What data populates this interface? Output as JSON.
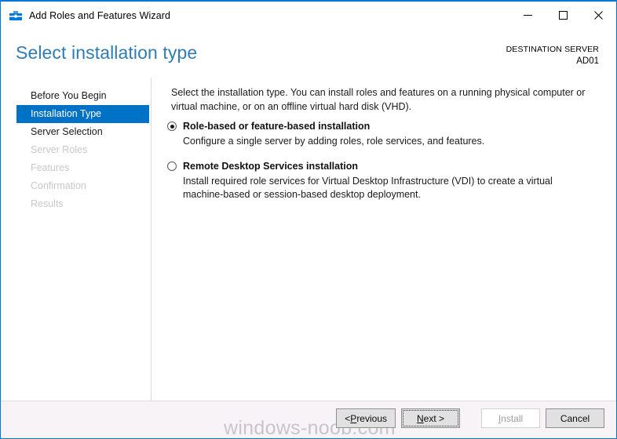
{
  "window": {
    "title": "Add Roles and Features Wizard",
    "icon": "roles-features-toolbox-icon",
    "accent_color": "#0078d7"
  },
  "window_controls": {
    "minimize": "minimize-icon",
    "maximize": "maximize-icon",
    "close": "close-icon"
  },
  "header": {
    "page_title": "Select installation type",
    "destination_label": "DESTINATION SERVER",
    "destination_server": "AD01",
    "title_color": "#2f7cb3"
  },
  "sidebar": {
    "selected_index": 1,
    "items": [
      {
        "label": "Before You Begin",
        "state": "enabled"
      },
      {
        "label": "Installation Type",
        "state": "selected"
      },
      {
        "label": "Server Selection",
        "state": "enabled"
      },
      {
        "label": "Server Roles",
        "state": "disabled"
      },
      {
        "label": "Features",
        "state": "disabled"
      },
      {
        "label": "Confirmation",
        "state": "disabled"
      },
      {
        "label": "Results",
        "state": "disabled"
      }
    ],
    "selected_bg": "#0072c6"
  },
  "main": {
    "instruction": "Select the installation type. You can install roles and features on a running physical computer or virtual machine, or on an offline virtual hard disk (VHD).",
    "options": [
      {
        "title": "Role-based or feature-based installation",
        "description": "Configure a single server by adding roles, role services, and features.",
        "checked": true
      },
      {
        "title": "Remote Desktop Services installation",
        "description": "Install required role services for Virtual Desktop Infrastructure (VDI) to create a virtual machine-based or session-based desktop deployment.",
        "checked": false
      }
    ]
  },
  "footer": {
    "watermark": "windows-noob.com",
    "buttons": {
      "previous": "< Previous",
      "next": "Next >",
      "install": "Install",
      "cancel": "Cancel"
    },
    "install_enabled": false,
    "focused_button": "next",
    "background": "#f7f3f7"
  }
}
